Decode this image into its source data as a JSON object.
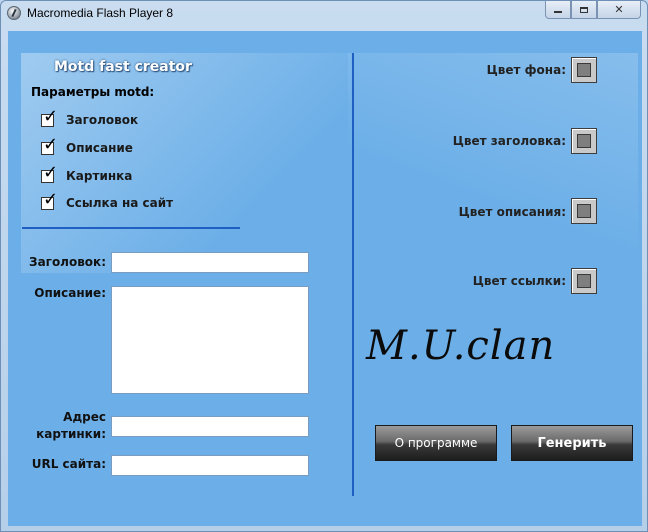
{
  "window": {
    "title": "Macromedia Flash Player 8",
    "controls": {
      "minimize": "minimize",
      "maximize": "maximize",
      "close": "✕"
    }
  },
  "app": {
    "heading": "Motd fast creator",
    "params_label": "Параметры motd:",
    "checkboxes": [
      {
        "label": "Заголовок",
        "checked": true
      },
      {
        "label": "Описание",
        "checked": true
      },
      {
        "label": "Картинка",
        "checked": true
      },
      {
        "label": "Ссылка на сайт",
        "checked": true
      }
    ],
    "checkmark_glyph": "✓",
    "form": {
      "title_label": "Заголовок:",
      "title_value": "",
      "description_label": "Описание:",
      "description_value": "",
      "image_label_line1": "Адрес",
      "image_label_line2": "картинки:",
      "image_value": "",
      "url_label": "URL сайта:",
      "url_value": ""
    },
    "colors": [
      {
        "label": "Цвет фона:"
      },
      {
        "label": "Цвет заголовка:"
      },
      {
        "label": "Цвет описания:"
      },
      {
        "label": "Цвет ссылки:"
      }
    ],
    "logo_text": "M.U.clan",
    "buttons": {
      "about": "О программе",
      "generate": "Генерить"
    },
    "palette": {
      "background": "#6cafe8",
      "divider": "#1f5fc4",
      "swatch": "#c9c9c9"
    }
  }
}
